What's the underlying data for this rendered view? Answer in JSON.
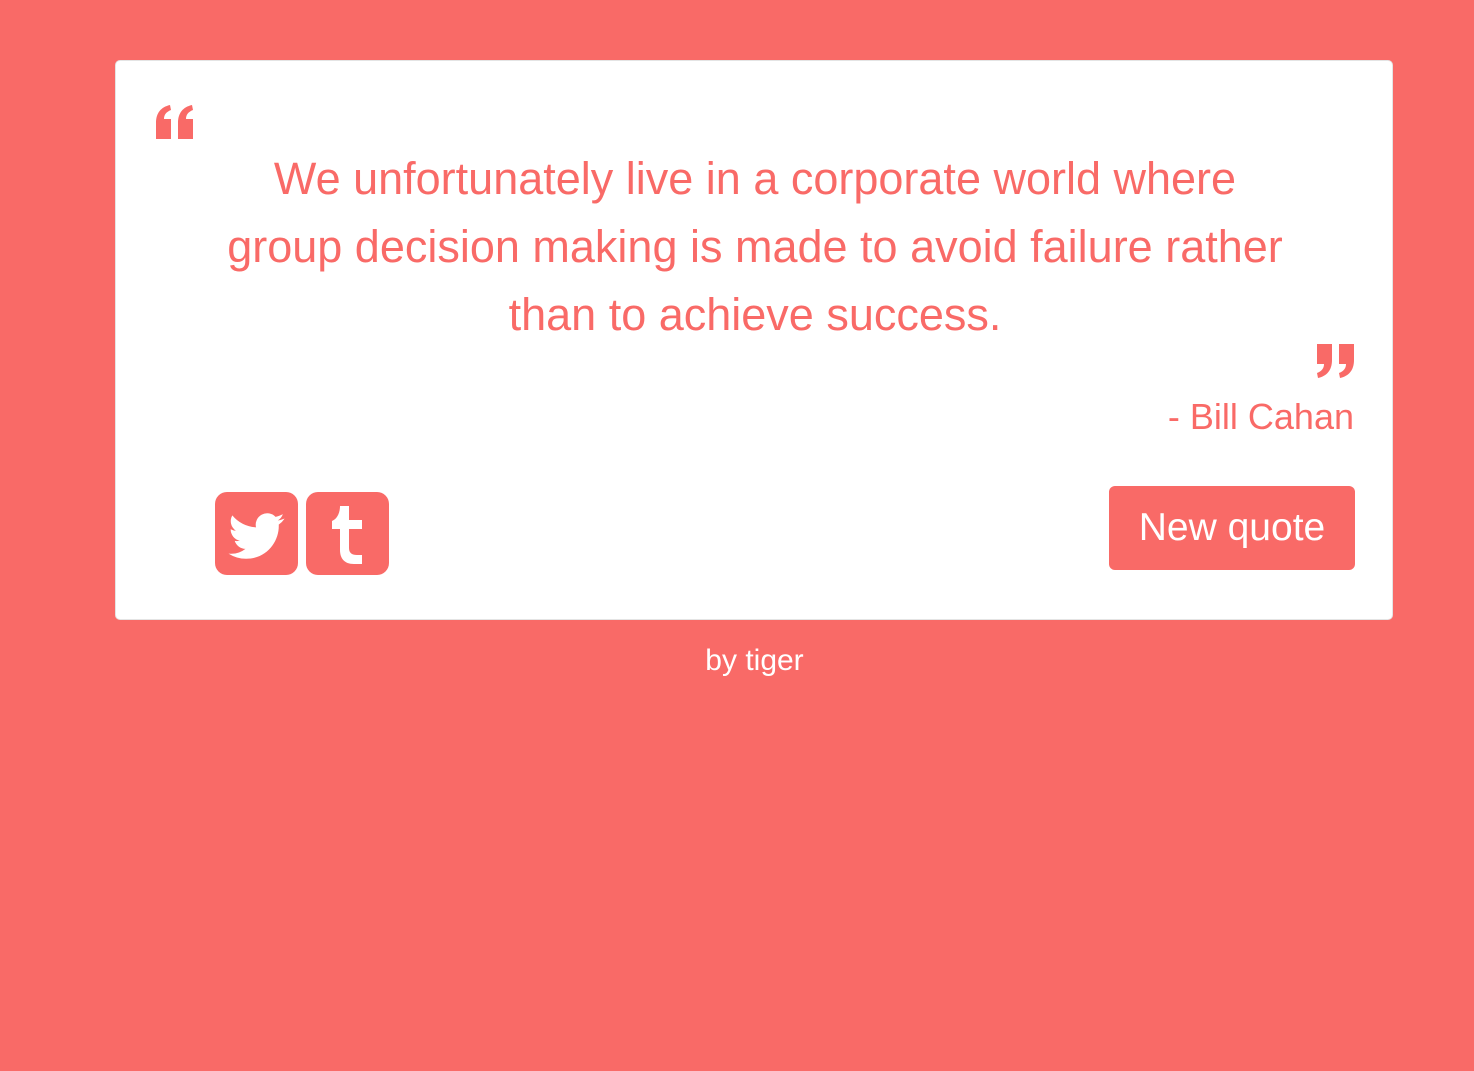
{
  "theme": {
    "background": "#F96A67",
    "card_background": "#FFFFFF",
    "accent": "#F96A67",
    "button_text": "#FFFFFF"
  },
  "quote": {
    "text": "We unfortunately live in a corporate world where group decision making is made to avoid failure rather than to achieve success.",
    "author": "- Bill Cahan",
    "open_icon": "quote-left-icon",
    "close_icon": "quote-right-icon"
  },
  "share": {
    "twitter_icon": "twitter-icon",
    "tumblr_icon": "tumblr-icon"
  },
  "actions": {
    "new_quote_label": "New quote"
  },
  "footer": {
    "credit": "by tiger"
  }
}
